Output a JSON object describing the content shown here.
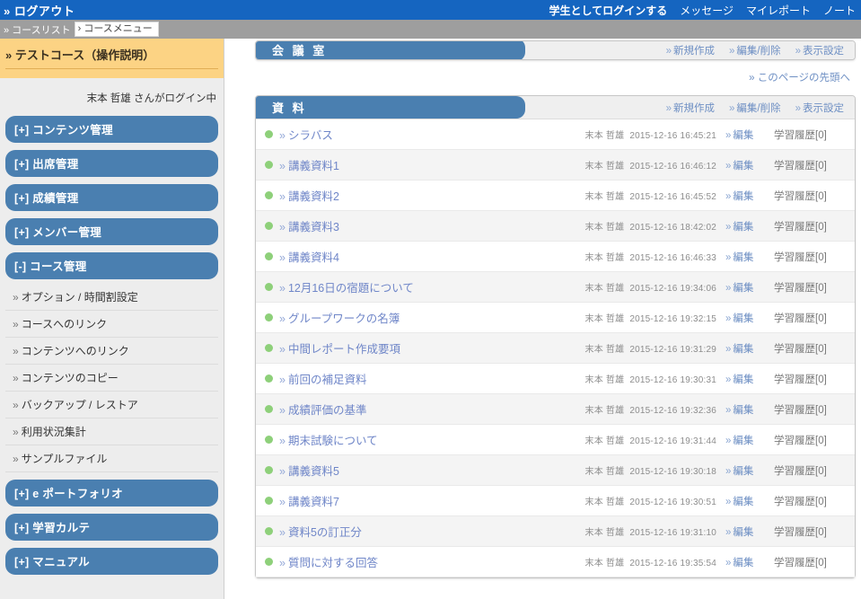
{
  "topbar": {
    "logout": "» ログアウト",
    "links": [
      {
        "label": "学生としてログインする",
        "bold": true
      },
      {
        "label": "メッセージ",
        "bold": false
      },
      {
        "label": "マイレポート",
        "bold": false
      },
      {
        "label": "ノート",
        "bold": false
      }
    ]
  },
  "breadcrumb": {
    "course_list": "» コースリスト",
    "course_menu": "› コースメニュー"
  },
  "sidebar": {
    "course_title": "» テストコース（操作説明）",
    "login_status": "末本 哲雄 さんがログイン中",
    "menu": [
      {
        "label": "[+] コンテンツ管理",
        "expanded": false
      },
      {
        "label": "[+] 出席管理",
        "expanded": false
      },
      {
        "label": "[+] 成績管理",
        "expanded": false
      },
      {
        "label": "[+] メンバー管理",
        "expanded": false
      },
      {
        "label": "[-] コース管理",
        "expanded": true
      }
    ],
    "submenu": [
      "オプション / 時間割設定",
      "コースへのリンク",
      "コンテンツへのリンク",
      "コンテンツのコピー",
      "バックアップ / レストア",
      "利用状況集計",
      "サンプルファイル"
    ],
    "menu_bottom": [
      {
        "label": "[+] e ポートフォリオ"
      },
      {
        "label": "[+] 学習カルテ"
      },
      {
        "label": "[+] マニュアル"
      }
    ]
  },
  "main": {
    "chevron": "»",
    "panel_links": [
      "新規作成",
      "編集/削除",
      "表示設定"
    ],
    "top_panel_title": "会 議 室",
    "back_to_top": "» このページの先頭へ",
    "materials_panel_title": "資 料",
    "edit_label": "編集",
    "history_label": "学習履歴[0]",
    "author": "末本 哲雄",
    "rows": [
      {
        "title": "シラバス",
        "date": "2015-12-16",
        "time": "16:45:21"
      },
      {
        "title": "講義資料1",
        "date": "2015-12-16",
        "time": "16:46:12"
      },
      {
        "title": "講義資料2",
        "date": "2015-12-16",
        "time": "16:45:52"
      },
      {
        "title": "講義資料3",
        "date": "2015-12-16",
        "time": "18:42:02"
      },
      {
        "title": "講義資料4",
        "date": "2015-12-16",
        "time": "16:46:33"
      },
      {
        "title": "12月16日の宿題について",
        "date": "2015-12-16",
        "time": "19:34:06"
      },
      {
        "title": "グループワークの名簿",
        "date": "2015-12-16",
        "time": "19:32:15"
      },
      {
        "title": "中間レポート作成要項",
        "date": "2015-12-16",
        "time": "19:31:29"
      },
      {
        "title": "前回の補足資料",
        "date": "2015-12-16",
        "time": "19:30:31"
      },
      {
        "title": "成績評価の基準",
        "date": "2015-12-16",
        "time": "19:32:36"
      },
      {
        "title": "期末試験について",
        "date": "2015-12-16",
        "time": "19:31:44"
      },
      {
        "title": "講義資料5",
        "date": "2015-12-16",
        "time": "19:30:18"
      },
      {
        "title": "講義資料7",
        "date": "2015-12-16",
        "time": "19:30:51"
      },
      {
        "title": "資料5の訂正分",
        "date": "2015-12-16",
        "time": "19:31:10"
      },
      {
        "title": "質問に対する回答",
        "date": "2015-12-16",
        "time": "19:35:54"
      }
    ]
  },
  "colors": {
    "topbar_blue": "#1565c0",
    "breadcrumb_gray": "#9e9e9e",
    "course_title_orange": "#fcd384",
    "menu_blue": "#4a7fb0",
    "link_blue": "#6f90c4",
    "bullet_green": "#8ed07a"
  }
}
